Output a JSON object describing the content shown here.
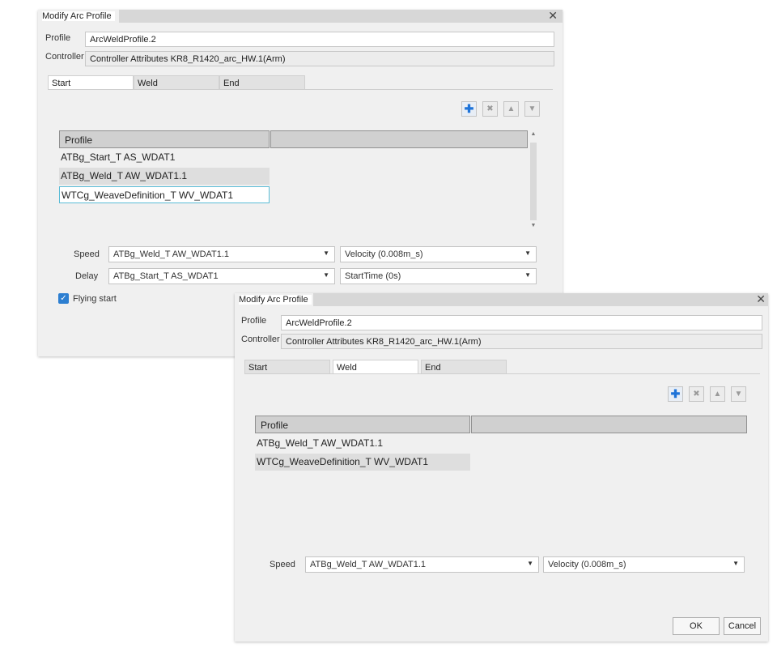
{
  "back_dialog": {
    "title": "Modify Arc Profile",
    "close_glyph": "✕",
    "profile_label": "Profile",
    "profile_value": "ArcWeldProfile.2",
    "controller_label": "Controller",
    "controller_value": "Controller Attributes KR8_R1420_arc_HW.1(Arm)",
    "tabs": [
      {
        "label": "Start"
      },
      {
        "label": "Weld"
      },
      {
        "label": "End"
      }
    ],
    "active_tab": "Start",
    "toolbar": {
      "add_icon": "plus-icon",
      "delete_icon": "delete-icon",
      "up_icon": "arrow-up-icon",
      "down_icon": "arrow-down-icon"
    },
    "list_header": "Profile",
    "items": [
      {
        "label": "ATBg_Start_T AS_WDAT1"
      },
      {
        "label": "ATBg_Weld_T AW_WDAT1.1"
      },
      {
        "label": "WTCg_WeaveDefinition_T WV_WDAT1"
      }
    ],
    "speed_label": "Speed",
    "speed_profile": "ATBg_Weld_T AW_WDAT1.1",
    "speed_value": "Velocity  (0.008m_s)",
    "delay_label": "Delay",
    "delay_profile": "ATBg_Start_T AS_WDAT1",
    "delay_value": "StartTime  (0s)",
    "flying_start_label": "Flying start",
    "flying_start_checked": true
  },
  "front_dialog": {
    "title": "Modify Arc Profile",
    "close_glyph": "✕",
    "profile_label": "Profile",
    "profile_value": "ArcWeldProfile.2",
    "controller_label": "Controller",
    "controller_value": "Controller Attributes KR8_R1420_arc_HW.1(Arm)",
    "tabs": [
      {
        "label": "Start"
      },
      {
        "label": "Weld"
      },
      {
        "label": "End"
      }
    ],
    "active_tab": "Weld",
    "toolbar": {
      "add_icon": "plus-icon",
      "delete_icon": "delete-icon",
      "up_icon": "arrow-up-icon",
      "down_icon": "arrow-down-icon"
    },
    "list_header": "Profile",
    "items": [
      {
        "label": "ATBg_Weld_T AW_WDAT1.1"
      },
      {
        "label": "WTCg_WeaveDefinition_T WV_WDAT1"
      }
    ],
    "speed_label": "Speed",
    "speed_profile": "ATBg_Weld_T AW_WDAT1.1",
    "speed_value": "Velocity  (0.008m_s)",
    "ok_label": "OK",
    "cancel_label": "Cancel"
  },
  "colors": {
    "accent": "#1e73d8",
    "focus_border": "#5bbcd6",
    "dialog_bg": "#f0f0f0"
  }
}
